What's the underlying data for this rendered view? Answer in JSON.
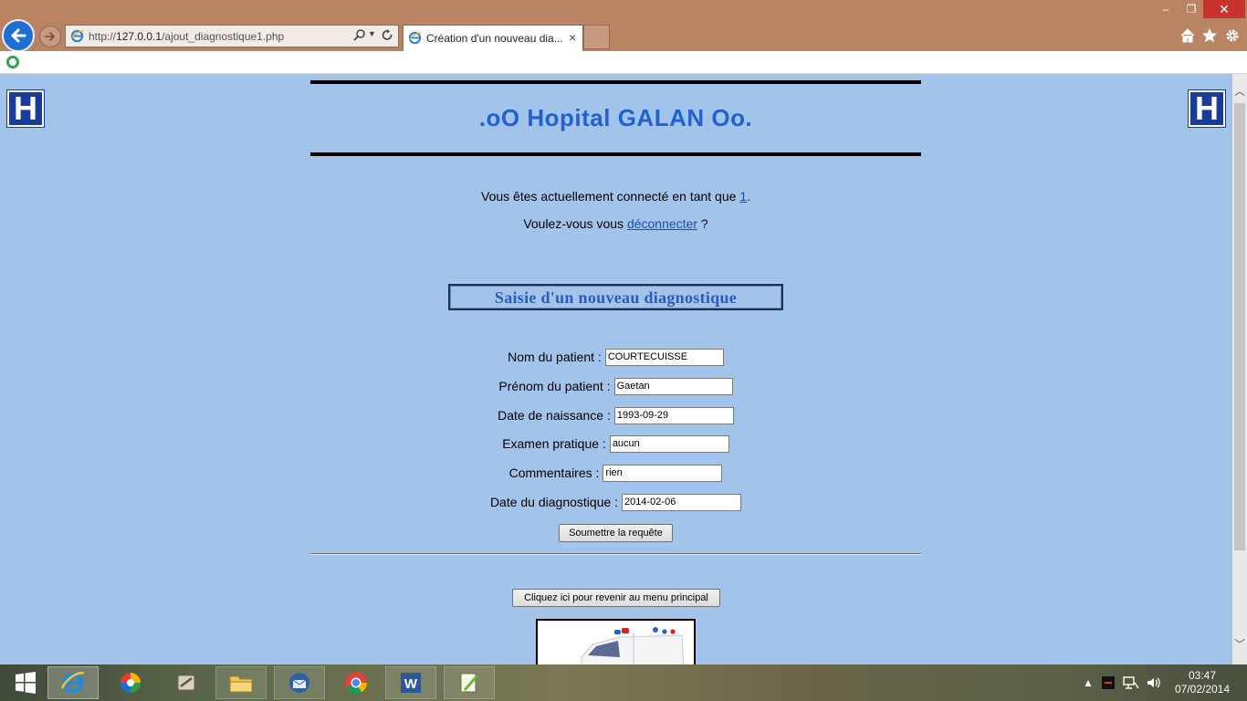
{
  "browser": {
    "url_prefix": "http://",
    "url_host": "127.0.0.1",
    "url_path": "/ajout_diagnostique1.php",
    "tab_title": "Création d'un nouveau dia...",
    "tab_close": "×",
    "win_minimize": "‒",
    "win_restore": "❐",
    "win_close": "✕"
  },
  "page": {
    "title": ".oO Hopital GALAN Oo.",
    "logo_letter": "H",
    "connected_prefix": "Vous êtes actuellement connecté en tant que ",
    "connected_user": "1",
    "connected_suffix": ".",
    "logout_prefix": "Voulez-vous vous ",
    "logout_link": "déconnecter",
    "logout_suffix": " ?",
    "section_title": "Saisie d'un nouveau diagnostique",
    "fields": [
      {
        "label": "Nom du patient :",
        "value": "COURTECUISSE"
      },
      {
        "label": "Prénom du patient :",
        "value": "Gaetan"
      },
      {
        "label": "Date de naissance :",
        "value": "1993-09-29"
      },
      {
        "label": "Examen pratique :",
        "value": "aucun"
      },
      {
        "label": "Commentaires :",
        "value": "rien"
      },
      {
        "label": "Date du diagnostique :",
        "value": "2014-02-06"
      }
    ],
    "submit_label": "Soumettre la requête",
    "menu_button_label": "Cliquez ici pour revenir au menu principal"
  },
  "taskbar": {
    "time": "03:47",
    "date": "07/02/2014",
    "apps": [
      "start-icon",
      "internet-explorer-icon",
      "color-app-icon",
      "tools-app-icon",
      "file-explorer-icon",
      "thunderbird-icon",
      "chrome-icon",
      "word-icon",
      "notepad-plus-icon"
    ]
  },
  "colors": {
    "page_bg": "#a3c4ea",
    "title_blue": "#2261d0",
    "chrome_bg": "#b98463",
    "logo_blue": "#193c9a"
  }
}
